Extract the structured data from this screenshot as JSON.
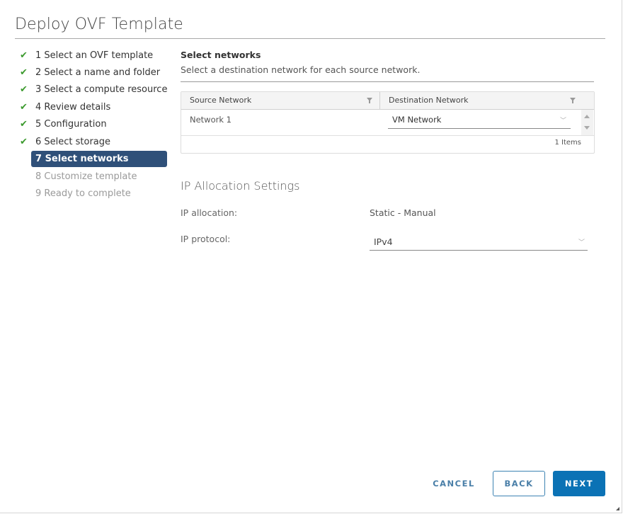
{
  "dialog": {
    "title": "Deploy OVF Template"
  },
  "steps": [
    {
      "label": "1 Select an OVF template",
      "state": "done"
    },
    {
      "label": "2 Select a name and folder",
      "state": "done"
    },
    {
      "label": "3 Select a compute resource",
      "state": "done"
    },
    {
      "label": "4 Review details",
      "state": "done"
    },
    {
      "label": "5 Configuration",
      "state": "done"
    },
    {
      "label": "6 Select storage",
      "state": "done"
    },
    {
      "label": "7 Select networks",
      "state": "current"
    },
    {
      "label": "8 Customize template",
      "state": "pending"
    },
    {
      "label": "9 Ready to complete",
      "state": "pending"
    }
  ],
  "icons": {
    "check": "✔",
    "chevron_down": "﹀"
  },
  "colors": {
    "accent": "#0b72b5",
    "current_step_bg": "#2f5079",
    "check_green": "#3c9a2e"
  },
  "networks": {
    "title": "Select networks",
    "description": "Select a destination network for each source network.",
    "columns": [
      "Source Network",
      "Destination Network"
    ],
    "rows": [
      {
        "source": "Network 1",
        "destination": "VM Network"
      }
    ],
    "footer": "1 Items"
  },
  "ip": {
    "title": "IP Allocation Settings",
    "allocation_label": "IP allocation:",
    "allocation_value": "Static - Manual",
    "protocol_label": "IP protocol:",
    "protocol_value": "IPv4"
  },
  "buttons": {
    "cancel": "CANCEL",
    "back": "BACK",
    "next": "NEXT"
  }
}
